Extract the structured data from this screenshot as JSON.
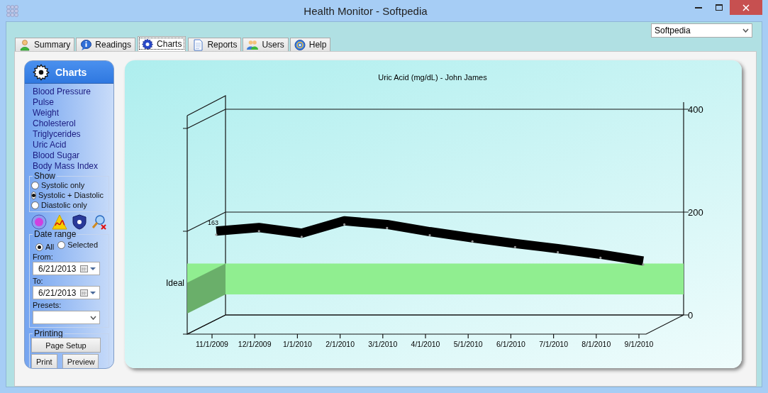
{
  "window": {
    "title": "Health Monitor - Softpedia"
  },
  "user_select": {
    "value": "Softpedia"
  },
  "tabs": [
    {
      "label": "Summary",
      "selected": false
    },
    {
      "label": "Readings",
      "selected": false
    },
    {
      "label": "Charts",
      "selected": true
    },
    {
      "label": "Reports",
      "selected": false
    },
    {
      "label": "Users",
      "selected": false
    },
    {
      "label": "Help",
      "selected": false
    }
  ],
  "sidebar": {
    "title": "Charts",
    "items": [
      "Blood Pressure",
      "Pulse",
      "Weight",
      "Cholesterol",
      "Triglycerides",
      "Uric Acid",
      "Blood Sugar",
      "Body Mass Index"
    ],
    "show": {
      "label": "Show",
      "options": [
        {
          "label": "Systolic only",
          "selected": false
        },
        {
          "label": "Systolic + Diastolic",
          "selected": true
        },
        {
          "label": "Diastolic only",
          "selected": false
        }
      ]
    },
    "date_range": {
      "label": "Date range",
      "options": [
        {
          "label": "All",
          "selected": true
        },
        {
          "label": "Selected",
          "selected": false
        }
      ],
      "from_label": "From:",
      "from": "6/21/2013",
      "to_label": "To:",
      "to": "6/21/2013",
      "presets_label": "Presets:"
    },
    "printing": {
      "label": "Printing",
      "buttons": [
        "Page Setup",
        "Print",
        "Preview"
      ]
    }
  },
  "chart": {
    "chart_data": {
      "type": "line",
      "title": "Uric Acid (mg/dL) - John James",
      "categories": [
        "11/1/2009",
        "12/1/2009",
        "1/1/2010",
        "2/1/2010",
        "3/1/2010",
        "4/1/2010",
        "5/1/2010",
        "6/1/2010",
        "7/1/2010",
        "8/1/2010",
        "9/1/2010"
      ],
      "series": [
        {
          "color": "#000000",
          "values": [
            163,
            170,
            159,
            183,
            176,
            162,
            150,
            139,
            129,
            118,
            105
          ]
        }
      ],
      "ylim": [
        0,
        400
      ],
      "yticks": [
        0,
        200,
        400
      ],
      "bands": [
        {
          "axis": "y",
          "from": 40,
          "to": 100,
          "color": "#90ee90",
          "label": "Ideal"
        }
      ],
      "annotations": [
        "163"
      ]
    }
  }
}
